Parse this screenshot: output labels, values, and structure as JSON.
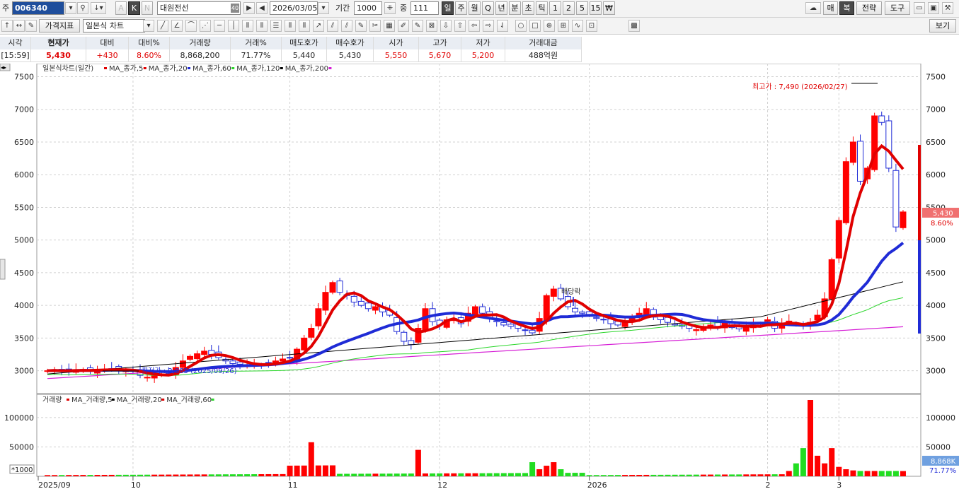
{
  "toolbar1": {
    "market_label": "주",
    "code": "006340",
    "stock_name": "대원전선",
    "stock_name_badge": "40",
    "date": "2026/03/05",
    "period_label": "기간",
    "period_value": "1000",
    "count_label": "중",
    "count_value": "111",
    "k_label": "K",
    "n_label": "N",
    "a_label": "A",
    "periods": [
      "일",
      "주",
      "월",
      "Q",
      "년",
      "분",
      "초",
      "틱",
      "1",
      "2",
      "5",
      "15",
      "₩"
    ],
    "right_buttons": [
      "매",
      "복",
      "전략",
      "도구"
    ]
  },
  "toolbar2": {
    "indicator_button": "가격지표",
    "chart_type": "일본식 차트",
    "view_button": "보기"
  },
  "quote": {
    "headers": [
      "시각",
      "현재가",
      "대비",
      "대비%",
      "거래량",
      "거래%",
      "매도호가",
      "매수호가",
      "시가",
      "고가",
      "저가",
      "거래대금"
    ],
    "values": [
      "[15:59]",
      "5,430",
      "+430",
      "8.60%",
      "8,868,200",
      "71.77%",
      "5,440",
      "5,430",
      "5,550",
      "5,670",
      "5,200",
      "488억원"
    ]
  },
  "price_legend": {
    "title": "일본식차트(일간)",
    "items": [
      {
        "label": "MA_종가,5",
        "color": "#e00000"
      },
      {
        "label": "MA_종가,20",
        "color": "#e00000"
      },
      {
        "label": "MA_종가,60",
        "color": "#1f2bd6"
      },
      {
        "label": "MA_종가,120",
        "color": "#2bd62b"
      },
      {
        "label": "MA_종가,200",
        "color": "#000000"
      }
    ],
    "last_marker_color": "#d61fd6"
  },
  "volume_legend": {
    "title": "거래량",
    "items": [
      {
        "label": "MA_거래량,5",
        "color": "#e00000"
      },
      {
        "label": "MA_거래량,20",
        "color": "#000000"
      },
      {
        "label": "MA_거래량,60",
        "color": "#e00000"
      }
    ],
    "last_marker_color": "#2bd62b",
    "unit": "*1000"
  },
  "annotations": {
    "high": "최고가 : 7,490 (2026/02/27)",
    "low": "최저가 : 2,885 (2025/09/26)",
    "dividend": "배당락"
  },
  "right_panel": {
    "price_tag": "5,430",
    "pct_tag": "8.60%",
    "vol_tag": "8,868K",
    "vol_pct": "71.77%"
  },
  "chart_data": [
    {
      "type": "candlestick",
      "title": "일본식차트(일간)",
      "y_ticks": [
        3000,
        3500,
        4000,
        4500,
        5000,
        5500,
        6000,
        6500,
        7000,
        7500
      ],
      "ylim": [
        2650,
        7700
      ],
      "x_tick_labels": [
        "2025/09",
        "10",
        "11",
        "12",
        "2026",
        "2",
        "3"
      ],
      "grid": true,
      "series_names": [
        "MA_종가,5",
        "MA_종가,20",
        "MA_종가,60",
        "MA_종가,120",
        "MA_종가,200"
      ],
      "ohlc_note": "approximate daily candles read from chart",
      "closes": [
        3000,
        3010,
        2990,
        3000,
        3010,
        3020,
        3000,
        3010,
        3020,
        3030,
        3010,
        3000,
        2990,
        2930,
        2900,
        2920,
        2950,
        2960,
        3050,
        3150,
        3220,
        3260,
        3300,
        3250,
        3200,
        3150,
        3110,
        3100,
        3090,
        3080,
        3090,
        3120,
        3150,
        3180,
        3200,
        3330,
        3500,
        3650,
        3950,
        4200,
        4350,
        4200,
        4150,
        4050,
        4000,
        3950,
        3980,
        3900,
        3850,
        3600,
        3450,
        3400,
        3650,
        3950,
        3750,
        3700,
        3780,
        3800,
        3720,
        3880,
        3980,
        3880,
        3800,
        3750,
        3700,
        3680,
        3650,
        3620,
        3580,
        3800,
        4150,
        4250,
        4100,
        3980,
        3900,
        3880,
        3850,
        3800,
        3780,
        3720,
        3700,
        3760,
        3800,
        3880,
        3950,
        3820,
        3780,
        3740,
        3700,
        3680,
        3650,
        3630,
        3650,
        3700,
        3680,
        3750,
        3660,
        3640,
        3670,
        3700,
        3720,
        3780,
        3650,
        3720,
        3760,
        3720,
        3690,
        3740,
        3850,
        4100,
        4700,
        5300,
        6200,
        6500,
        5900,
        6100,
        6900,
        6800,
        6100,
        5200,
        5430
      ],
      "ma5_end": 5640,
      "ma20_end": 5150,
      "ma60_end": 4300,
      "ma120_end": 4010,
      "ma200_end": 3680,
      "high": 7490,
      "low": 2885
    },
    {
      "type": "bar",
      "title": "거래량",
      "unit": "*1000",
      "y_ticks": [
        50000,
        100000
      ],
      "ylim": [
        0,
        130000
      ],
      "values_note": "volume in thousands, approximate",
      "peaks": [
        {
          "label": "11",
          "value": 58000
        },
        {
          "label": "11/24",
          "value": 45000
        },
        {
          "label": "2/26",
          "value": 130000
        },
        {
          "label": "2/25",
          "value": 48000
        },
        {
          "label": "3/03",
          "value": 48000
        },
        {
          "label": "last",
          "value": 8868
        }
      ]
    }
  ]
}
